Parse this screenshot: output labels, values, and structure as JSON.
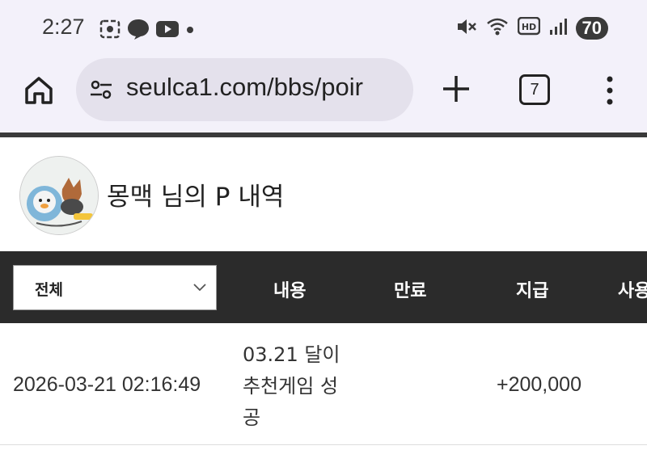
{
  "status_bar": {
    "time": "2:27",
    "battery": "70",
    "left_icons": [
      "screenshot-icon",
      "chat-icon",
      "youtube-icon",
      "dot-icon"
    ],
    "right_icons": [
      "mute-icon",
      "wifi-icon",
      "hd-icon",
      "signal-icon"
    ]
  },
  "browser": {
    "url": "seulca1.com/bbs/poir",
    "tab_count": "7"
  },
  "profile": {
    "title": "몽맥 님의 P 내역"
  },
  "table": {
    "filter_selected": "전체",
    "headers": [
      "내용",
      "만료",
      "지급",
      "사용"
    ],
    "rows": [
      {
        "date": "2026-03-21 02:16:49",
        "content": "03.21 달이 추천게임 성공",
        "expiry": "",
        "amount": "+200,000"
      }
    ]
  },
  "colors": {
    "chrome_bg": "#f3f1fa",
    "url_bg": "#e4e1ec",
    "header_bg": "#2b2b2b"
  }
}
